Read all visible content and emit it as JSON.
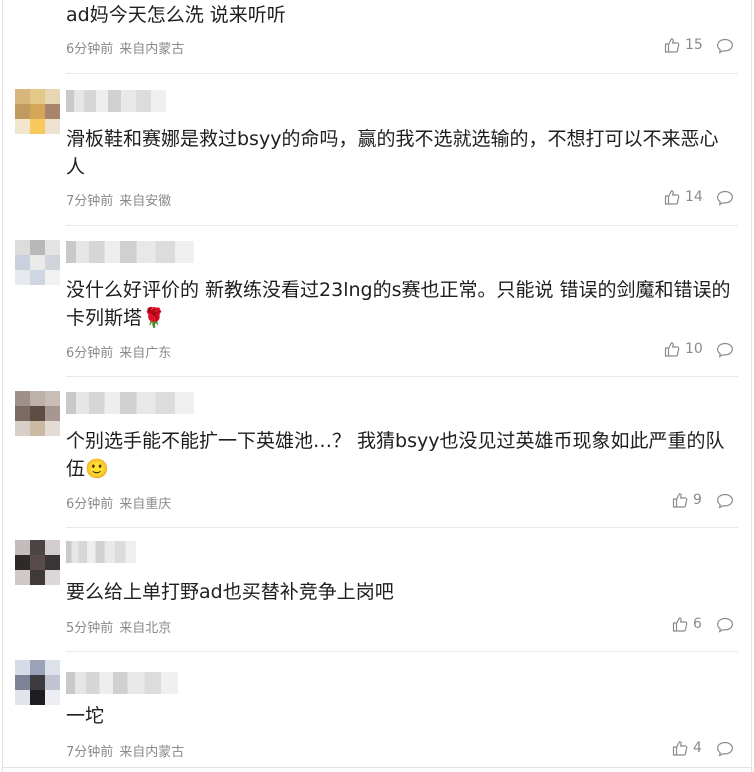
{
  "comments": [
    {
      "text": "ad妈今天怎么洗 说来听听",
      "time": "6分钟前",
      "location": "来自内蒙古",
      "likes": "15"
    },
    {
      "text": "滑板鞋和赛娜是救过bsyy的命吗，赢的我不选就选输的，不想打可以不来恶心人",
      "time": "7分钟前",
      "location": "来自安徽",
      "likes": "14"
    },
    {
      "text": "没什么好评价的 新教练没看过23lng的s赛也正常。只能说 错误的剑魔和错误的卡列斯塔🌹",
      "time": "6分钟前",
      "location": "来自广东",
      "likes": "10"
    },
    {
      "text": "个别选手能不能扩一下英雄池…？ 我猜bsyy也没见过英雄币现象如此严重的队伍🙂",
      "time": "6分钟前",
      "location": "来自重庆",
      "likes": "9"
    },
    {
      "text": "要么给上单打野ad也买替补竞争上岗吧",
      "time": "5分钟前",
      "location": "来自北京",
      "likes": "6"
    },
    {
      "text": "一坨",
      "time": "7分钟前",
      "location": "来自内蒙古",
      "likes": "4"
    }
  ],
  "icons": {
    "like": "thumbs-up-icon",
    "reply": "comment-bubble-icon"
  },
  "colors": {
    "meta": "#8a8a8a",
    "text": "#1e1e1e",
    "divider": "#e9e9e9"
  }
}
